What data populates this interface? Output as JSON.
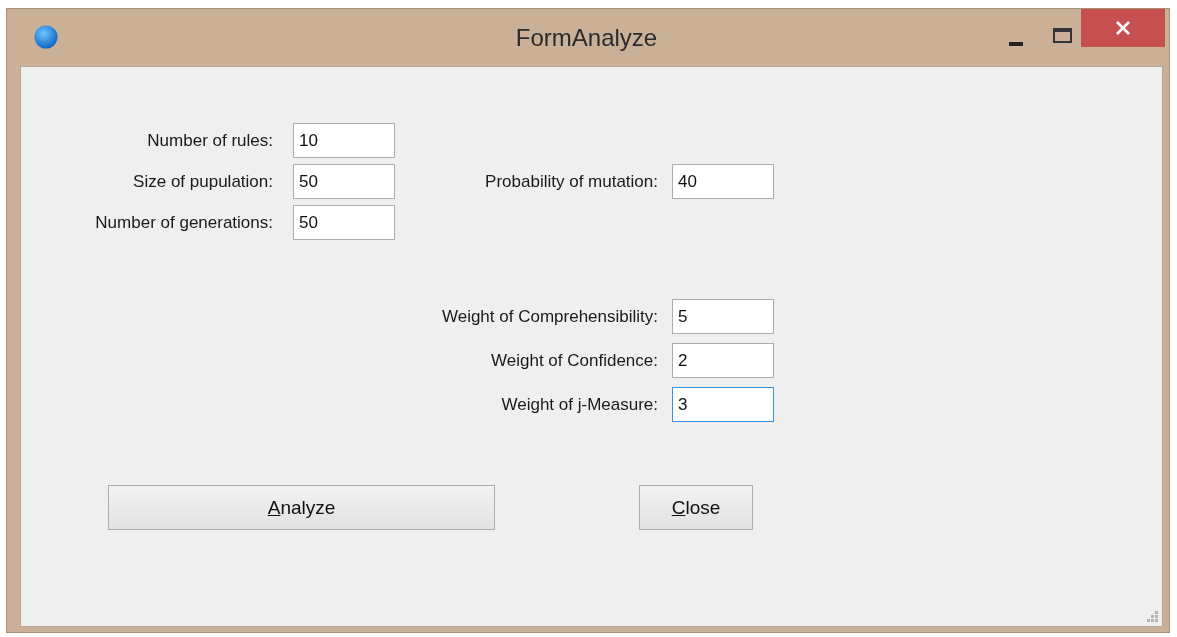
{
  "window": {
    "title": "FormAnalyze"
  },
  "parameters": [
    {
      "label": "Number of rules:",
      "value": "10",
      "focused": false
    },
    {
      "label": "Size of pupulation:",
      "value": "50",
      "focused": false
    },
    {
      "label": "Number of generations:",
      "value": "50",
      "focused": false
    }
  ],
  "mutation": {
    "label": "Probability of mutation:",
    "value": "40",
    "focused": false
  },
  "weights": [
    {
      "label": "Weight of Comprehensibility:",
      "value": "5",
      "focused": false
    },
    {
      "label": "Weight of Confidence:",
      "value": "2",
      "focused": false
    },
    {
      "label": "Weight of j-Measure:",
      "value": "3",
      "focused": true
    }
  ],
  "buttons": [
    {
      "label": "Analyze",
      "first_letter_underlined": true,
      "kind": "wide"
    },
    {
      "label": "Close",
      "first_letter_underlined": true,
      "kind": "narrow"
    }
  ]
}
